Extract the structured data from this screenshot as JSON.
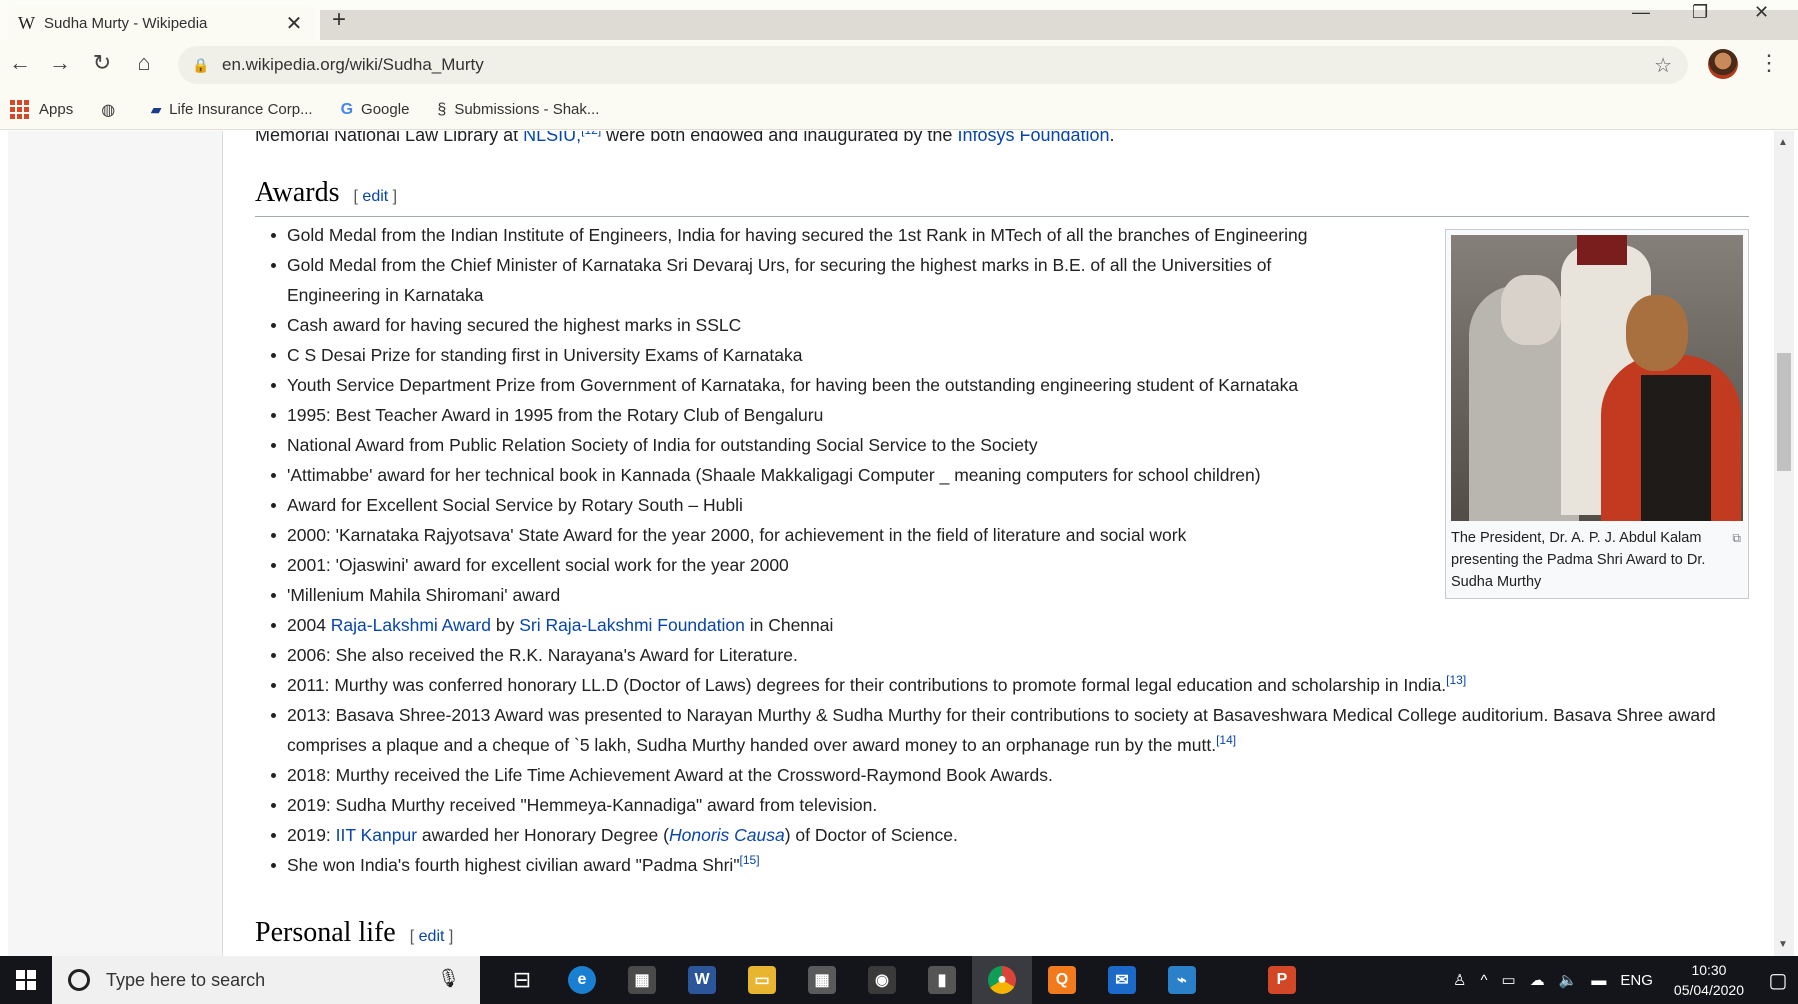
{
  "browser": {
    "tab_title": "Sudha Murty - Wikipedia",
    "tab_favicon": "W",
    "url": "en.wikipedia.org/wiki/Sudha_Murty"
  },
  "bookmarks": [
    {
      "label": "Apps"
    },
    {
      "label": ""
    },
    {
      "label": "Life Insurance Corp..."
    },
    {
      "label": "Google"
    },
    {
      "label": "Submissions - Shak..."
    }
  ],
  "article": {
    "top_line_pre": "Memorial National Law Library at ",
    "top_line_link1": "NLSIU,",
    "top_line_mid": " were both endowed and inaugurated by the ",
    "top_line_link2": "Infosys Foundation",
    "top_line_post": ".",
    "awards_heading": "Awards",
    "edit_label": "edit",
    "personal_heading": "Personal life",
    "awards": [
      {
        "text": "Gold Medal from the Indian Institute of Engineers, India for having secured the 1st Rank in MTech of all the branches of Engineering"
      },
      {
        "text": "Gold Medal from the Chief Minister of Karnataka Sri Devaraj Urs, for securing the highest marks in B.E. of all the Universities of Engineering in Karnataka"
      },
      {
        "text": "Cash award for having secured the highest marks in SSLC"
      },
      {
        "text": "C S Desai Prize for standing first in University Exams of Karnataka"
      },
      {
        "text": "Youth Service Department Prize from Government of Karnataka, for having been the outstanding engineering student of Karnataka"
      },
      {
        "text": "1995: Best Teacher Award in 1995 from the Rotary Club of Bengaluru"
      },
      {
        "text": "National Award from Public Relation Society of India for outstanding Social Service to the Society"
      },
      {
        "text": "'Attimabbe' award for her technical book in Kannada (Shaale Makkaligagi Computer _ meaning computers for school children)"
      },
      {
        "text": "Award for Excellent Social Service by Rotary South – Hubli"
      },
      {
        "text": "2000: 'Karnataka Rajyotsava' State Award for the year 2000, for achievement in the field of literature and social work"
      },
      {
        "text": "2001: 'Ojaswini' award for excellent social work for the year 2000"
      },
      {
        "text": "'Millenium Mahila Shiromani' award"
      }
    ],
    "award_2004": {
      "pre": "2004 ",
      "link1": "Raja-Lakshmi Award",
      "mid": " by ",
      "link2": "Sri Raja-Lakshmi Foundation",
      "post": " in Chennai"
    },
    "award_2006": "2006: She also received the R.K. Narayana's Award for Literature.",
    "award_2011": {
      "text": "2011: Murthy was conferred honorary LL.D (Doctor of Laws) degrees for their contributions to promote formal legal education and scholarship in India.",
      "ref": "[13]"
    },
    "award_2013": {
      "text": "2013: Basava Shree-2013 Award was presented to Narayan Murthy & Sudha Murthy for their contributions to society at Basaveshwara Medical College auditorium. Basava Shree award comprises a plaque and a cheque of `5 lakh, Sudha Murthy handed over award money to an orphanage run by the mutt.",
      "ref": "[14]"
    },
    "award_2018": "2018: Murthy received the Life Time Achievement Award at the Crossword-Raymond Book Awards.",
    "award_2019a": "2019: Sudha Murthy received \"Hemmeya-Kannadiga\" award from television.",
    "award_2019b": {
      "pre": "2019: ",
      "link": "IIT Kanpur",
      "mid": " awarded her Honorary Degree (",
      "link2": "Honoris Causa",
      "post": ") of Doctor of Science."
    },
    "award_padma": {
      "text": "She won India's fourth highest civilian award \"Padma Shri\"",
      "ref": "[15]"
    },
    "image_caption": "The President, Dr. A. P. J. Abdul Kalam presenting the Padma Shri Award to Dr. Sudha Murthy"
  },
  "taskbar": {
    "search_placeholder": "Type here to search",
    "language": "ENG",
    "time": "10:30",
    "date": "05/04/2020"
  }
}
